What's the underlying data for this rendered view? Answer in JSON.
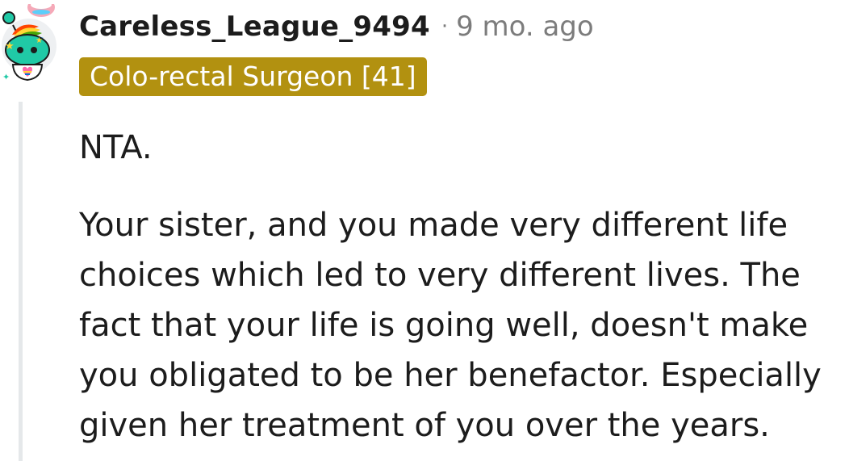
{
  "comment": {
    "author": "Careless_League_9494",
    "separator": "·",
    "time_ago": "9 mo. ago",
    "flair": "Colo-rectal Surgeon [41]",
    "avatar_icon": "snoo-avatar-icon",
    "paragraphs": [
      "NTA.",
      "Your sister, and you made very different life choices which led to very different lives. The fact that your life is going well, doesn't make you obligated to be her benefactor. Especially given her treatment of you over the years."
    ]
  },
  "colors": {
    "flair_bg": "#b29110",
    "text": "#1c1c1c",
    "meta_gray": "#7c7c7c",
    "thread_line": "#e5e8ea"
  }
}
